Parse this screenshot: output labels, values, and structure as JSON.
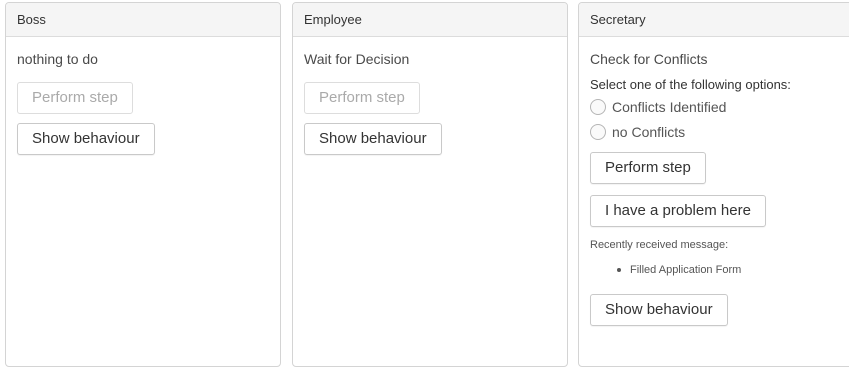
{
  "panels": [
    {
      "title": "Boss",
      "step": "nothing to do",
      "perform_label": "Perform step",
      "show_label": "Show behaviour"
    },
    {
      "title": "Employee",
      "step": "Wait for Decision",
      "perform_label": "Perform step",
      "show_label": "Show behaviour"
    },
    {
      "title": "Secretary",
      "step": "Check for Conflicts",
      "options_label": "Select one of the following options:",
      "options": [
        "Conflicts Identified",
        "no Conflicts"
      ],
      "perform_label": "Perform step",
      "problem_label": "I have a problem here",
      "recent_label": "Recently received message:",
      "messages": [
        "Filled Application Form"
      ],
      "show_label": "Show behaviour"
    }
  ]
}
